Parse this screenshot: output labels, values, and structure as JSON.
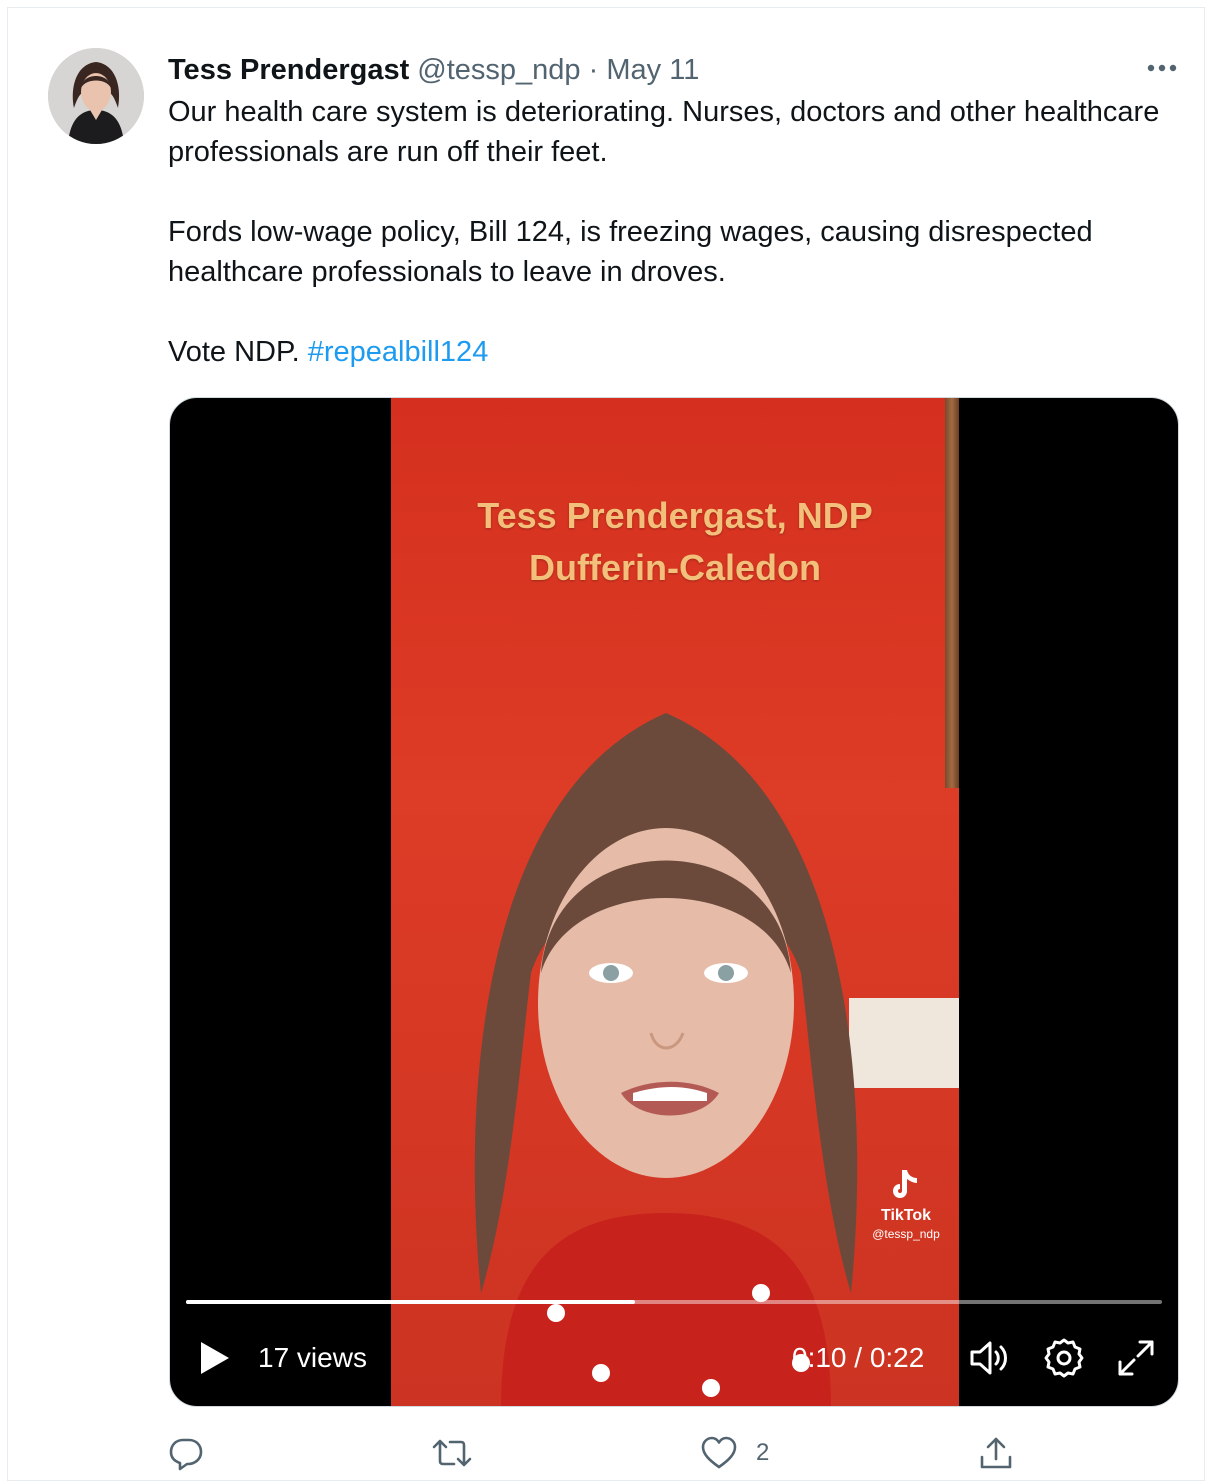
{
  "tweet": {
    "author_name": "Tess Prendergast",
    "handle": "@tessp_ndp",
    "separator": "·",
    "date": "May 11",
    "paragraphs": [
      "Our health care system is deteriorating. Nurses, doctors and other healthcare professionals are run off their feet.",
      "Fords low-wage policy, Bill 124, is freezing wages, causing disrespected healthcare professionals to leave in droves."
    ],
    "last_line_text": "Vote NDP.",
    "hashtag": "#repealbill124"
  },
  "video": {
    "overlay_title_line1": "Tess Prendergast, NDP",
    "overlay_title_line2": "Dufferin-Caledon",
    "watermark_brand": "TikTok",
    "watermark_handle": "@tessp_ndp",
    "views": "17 views",
    "timecode": "0:10 / 0:22",
    "progress": 0.46
  },
  "actions": {
    "reply_count": "",
    "retweet_count": "",
    "like_count": "2",
    "share_count": ""
  },
  "icons": {
    "more": "more-horizontal-icon",
    "play": "play-icon",
    "volume": "volume-icon",
    "settings": "gear-icon",
    "fullscreen": "expand-icon",
    "reply": "reply-icon",
    "retweet": "retweet-icon",
    "like": "heart-icon",
    "share": "share-icon"
  },
  "colors": {
    "link": "#1d9bf0",
    "secondary_text": "#536471",
    "video_background": "#d5301f"
  }
}
